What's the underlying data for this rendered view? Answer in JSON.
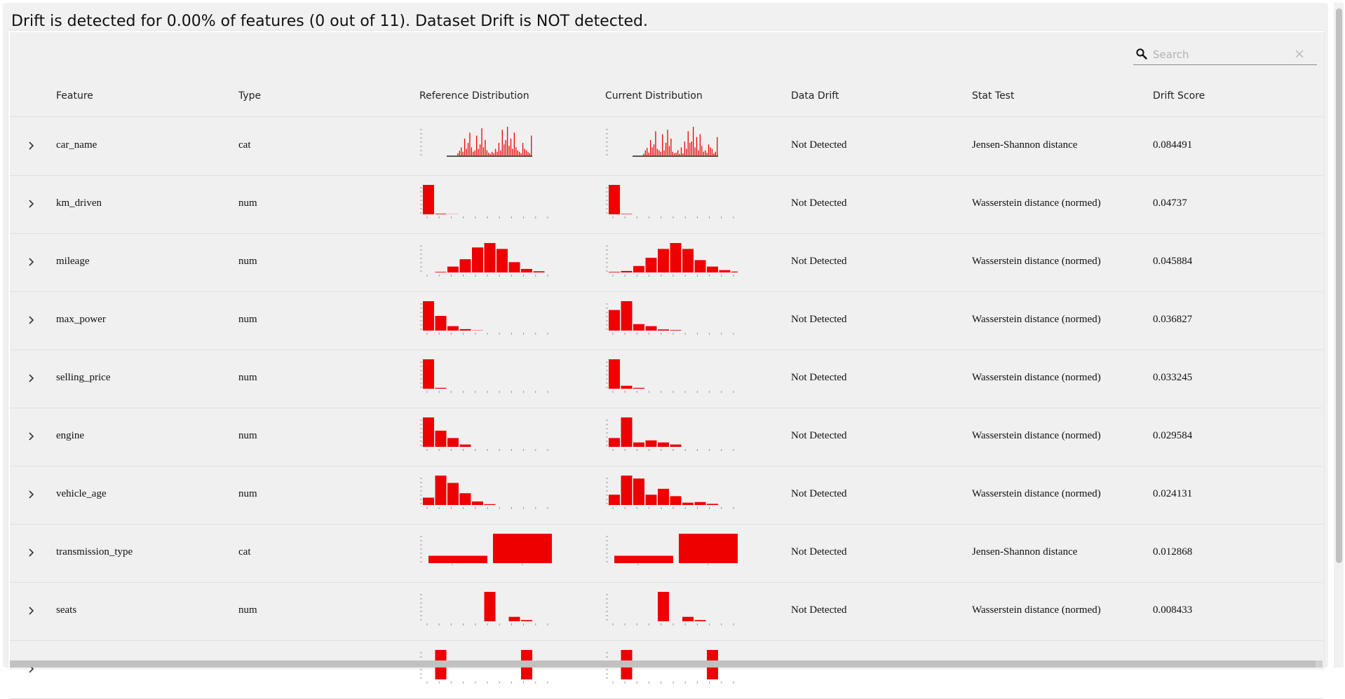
{
  "summary": "Drift is detected for 0.00% of features (0 out of 11). Dataset Drift is NOT detected.",
  "search": {
    "placeholder": "Search",
    "value": ""
  },
  "columns": {
    "feature": "Feature",
    "type": "Type",
    "reference": "Reference Distribution",
    "current": "Current Distribution",
    "drift": "Data Drift",
    "stat": "Stat Test",
    "score": "Drift Score"
  },
  "colors": {
    "bar": "#ee0000",
    "axis": "#999999",
    "background": "#f0f0f0"
  },
  "icons": {
    "search": "search-icon",
    "clear": "close-icon",
    "expand": "chevron-right-icon"
  },
  "rows": [
    {
      "feature": "car_name",
      "type": "cat",
      "drift": "Not Detected",
      "stat": "Jensen-Shannon distance",
      "score": "0.084491",
      "chart_style": "spikes",
      "ref": [
        0,
        0,
        0,
        0,
        0,
        0,
        0.1,
        0.18,
        0.3,
        0.15,
        0.6,
        0.25,
        0.45,
        0.8,
        0.3,
        0.15,
        0.2,
        0.7,
        0.25,
        0.4,
        0.95,
        0.3,
        0.55,
        0.2,
        0.12,
        0.08,
        0.15,
        0.1,
        0.25,
        0.15,
        0.45,
        0.2,
        0.9,
        0.4,
        0.55,
        1.0,
        0.35,
        0.6,
        0.25,
        0.8,
        0.3,
        0.2,
        0.15,
        0.1,
        0.45,
        0.25,
        0.2,
        0.15,
        0.1,
        0.7
      ],
      "cur": [
        0,
        0,
        0,
        0,
        0,
        0,
        0.08,
        0.2,
        0.28,
        0.12,
        0.55,
        0.3,
        0.4,
        0.85,
        0.25,
        0.2,
        0.15,
        0.75,
        0.2,
        0.45,
        0.9,
        0.35,
        0.6,
        0.15,
        0.1,
        0.12,
        0.2,
        0.08,
        0.3,
        0.1,
        0.5,
        0.25,
        0.85,
        0.45,
        0.5,
        1.0,
        0.3,
        0.65,
        0.2,
        0.75,
        0.35,
        0.15,
        0.2,
        0.12,
        0.4,
        0.3,
        0.25,
        0.1,
        0.15,
        0.65
      ]
    },
    {
      "feature": "km_driven",
      "type": "num",
      "drift": "Not Detected",
      "stat": "Wasserstein distance (normed)",
      "score": "0.04737",
      "chart_style": "hist",
      "ref": [
        1.0,
        0.02,
        0.005,
        0,
        0,
        0,
        0,
        0,
        0,
        0
      ],
      "cur": [
        1.0,
        0.015,
        0,
        0,
        0,
        0,
        0,
        0,
        0,
        0
      ]
    },
    {
      "feature": "mileage",
      "type": "num",
      "drift": "Not Detected",
      "stat": "Wasserstein distance (normed)",
      "score": "0.045884",
      "chart_style": "hist",
      "ref": [
        0,
        0.02,
        0.2,
        0.45,
        0.85,
        1.0,
        0.8,
        0.35,
        0.12,
        0.04
      ],
      "cur": [
        0.02,
        0.05,
        0.22,
        0.5,
        0.8,
        1.0,
        0.8,
        0.42,
        0.2,
        0.08,
        0.03
      ]
    },
    {
      "feature": "max_power",
      "type": "num",
      "drift": "Not Detected",
      "stat": "Wasserstein distance (normed)",
      "score": "0.036827",
      "chart_style": "hist",
      "ref": [
        1.0,
        0.5,
        0.15,
        0.05,
        0.01,
        0,
        0,
        0,
        0,
        0
      ],
      "cur": [
        0.7,
        1.0,
        0.22,
        0.15,
        0.04,
        0.02,
        0,
        0,
        0,
        0
      ]
    },
    {
      "feature": "selling_price",
      "type": "num",
      "drift": "Not Detected",
      "stat": "Wasserstein distance (normed)",
      "score": "0.033245",
      "chart_style": "hist",
      "ref": [
        1.0,
        0.03,
        0,
        0,
        0,
        0,
        0,
        0,
        0,
        0
      ],
      "cur": [
        1.0,
        0.1,
        0.03,
        0,
        0,
        0,
        0,
        0,
        0,
        0
      ]
    },
    {
      "feature": "engine",
      "type": "num",
      "drift": "Not Detected",
      "stat": "Wasserstein distance (normed)",
      "score": "0.029584",
      "chart_style": "hist",
      "ref": [
        1.0,
        0.55,
        0.3,
        0.08,
        0,
        0,
        0,
        0,
        0,
        0
      ],
      "cur": [
        0.3,
        1.0,
        0.15,
        0.22,
        0.15,
        0.08,
        0,
        0,
        0,
        0
      ]
    },
    {
      "feature": "vehicle_age",
      "type": "num",
      "drift": "Not Detected",
      "stat": "Wasserstein distance (normed)",
      "score": "0.024131",
      "chart_style": "hist",
      "ref": [
        0.25,
        1.0,
        0.75,
        0.4,
        0.12,
        0.03,
        0,
        0,
        0,
        0
      ],
      "cur": [
        0.35,
        1.0,
        0.9,
        0.35,
        0.55,
        0.3,
        0.08,
        0.1,
        0.04,
        0,
        0
      ]
    },
    {
      "feature": "transmission_type",
      "type": "cat",
      "drift": "Not Detected",
      "stat": "Jensen-Shannon distance",
      "score": "0.012868",
      "chart_style": "cat",
      "ref": [
        0.25,
        1.0
      ],
      "cur": [
        0.25,
        1.0
      ]
    },
    {
      "feature": "seats",
      "type": "num",
      "drift": "Not Detected",
      "stat": "Wasserstein distance (normed)",
      "score": "0.008433",
      "chart_style": "hist",
      "ref": [
        0,
        0,
        0,
        0,
        0,
        1.0,
        0,
        0.15,
        0.04,
        0,
        0
      ],
      "cur": [
        0,
        0,
        0,
        0,
        1.0,
        0,
        0.15,
        0.04,
        0,
        0,
        0
      ]
    },
    {
      "feature": "",
      "type": "",
      "drift": "",
      "stat": "",
      "score": "",
      "chart_style": "hist",
      "ref": [
        0,
        1.0,
        0,
        0,
        0,
        0,
        0,
        0,
        1.0,
        0
      ],
      "cur": [
        0,
        1.0,
        0,
        0,
        0,
        0,
        0,
        0,
        1.0,
        0
      ]
    }
  ]
}
